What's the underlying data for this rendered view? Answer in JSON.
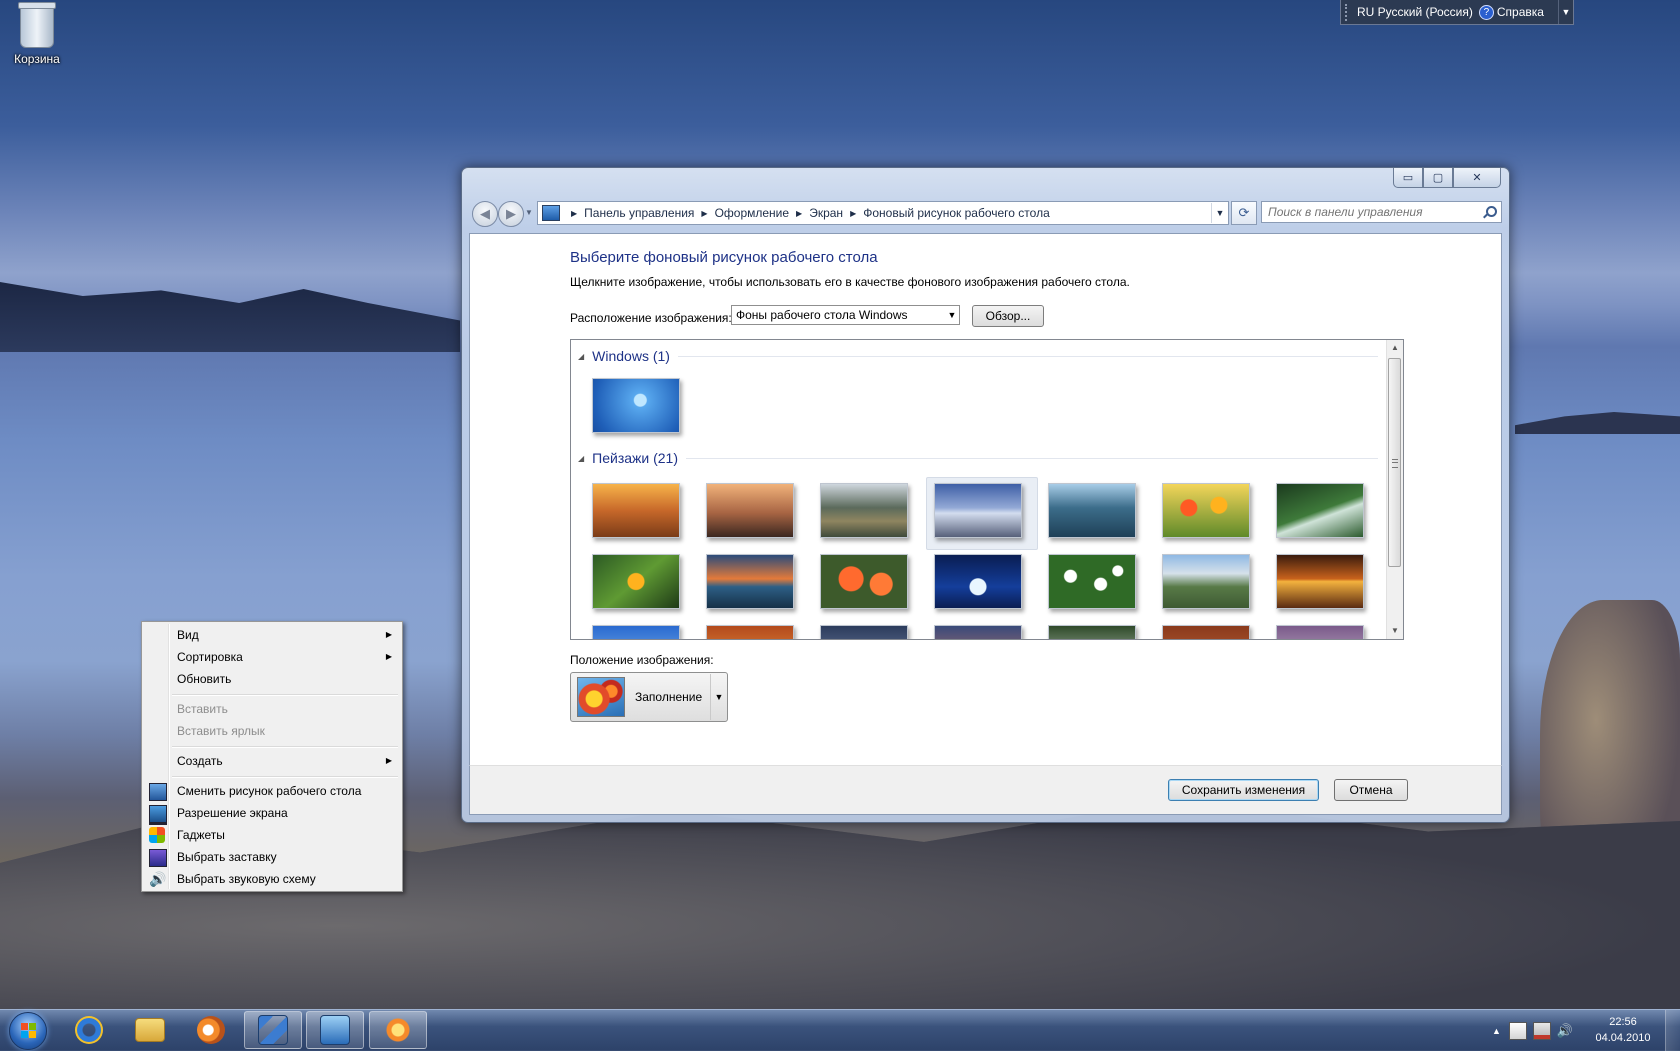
{
  "desktop": {
    "icons": [
      {
        "label": "Корзина",
        "icon": "recycle-bin-icon"
      }
    ]
  },
  "language_bar": {
    "language": "RU Русский (Россия)",
    "help": "Справка"
  },
  "window": {
    "controls": {
      "minimize": "▭",
      "maximize": "▢",
      "close": "✕"
    },
    "breadcrumbs": [
      "Панель управления",
      "Оформление",
      "Экран",
      "Фоновый рисунок рабочего стола"
    ],
    "search": {
      "placeholder": "Поиск в панели управления"
    },
    "heading": "Выберите фоновый рисунок рабочего стола",
    "subtext": "Щелкните изображение, чтобы использовать его в качестве фонового изображения рабочего стола.",
    "location": {
      "label": "Расположение изображения:",
      "value": "Фоны рабочего стола Windows",
      "browse": "Обзор..."
    },
    "gallery": {
      "groups": [
        {
          "title": "Windows (1)",
          "count": 1
        },
        {
          "title": "Пейзажи (21)",
          "count": 21,
          "selected_index": 3
        }
      ]
    },
    "position": {
      "label": "Положение изображения:",
      "value": "Заполнение"
    },
    "buttons": {
      "save": "Сохранить изменения",
      "cancel": "Отмена"
    }
  },
  "context_menu": {
    "items": [
      {
        "label": "Вид",
        "submenu": true
      },
      {
        "label": "Сортировка",
        "submenu": true
      },
      {
        "label": "Обновить"
      },
      {
        "label": "Вставить",
        "disabled": true
      },
      {
        "label": "Вставить ярлык",
        "disabled": true
      },
      {
        "label": "Создать",
        "submenu": true
      },
      {
        "label": "Сменить рисунок рабочего стола",
        "icon": "desktop-background-icon"
      },
      {
        "label": "Разрешение экрана",
        "icon": "monitor-icon"
      },
      {
        "label": "Гаджеты",
        "icon": "gadgets-icon"
      },
      {
        "label": "Выбрать заставку",
        "icon": "screensaver-icon"
      },
      {
        "label": "Выбрать звуковую схему",
        "icon": "speaker-icon"
      }
    ]
  },
  "taskbar": {
    "pinned": [
      "internet-explorer-icon",
      "explorer-folder-icon",
      "media-player-icon",
      "network-app-icon",
      "control-panel-icon",
      "paint-app-icon"
    ],
    "clock": {
      "time": "22:56",
      "date": "04.04.2010"
    }
  },
  "colors": {
    "heading_blue": "#1e3287",
    "accent_border": "#3c7fb1"
  }
}
